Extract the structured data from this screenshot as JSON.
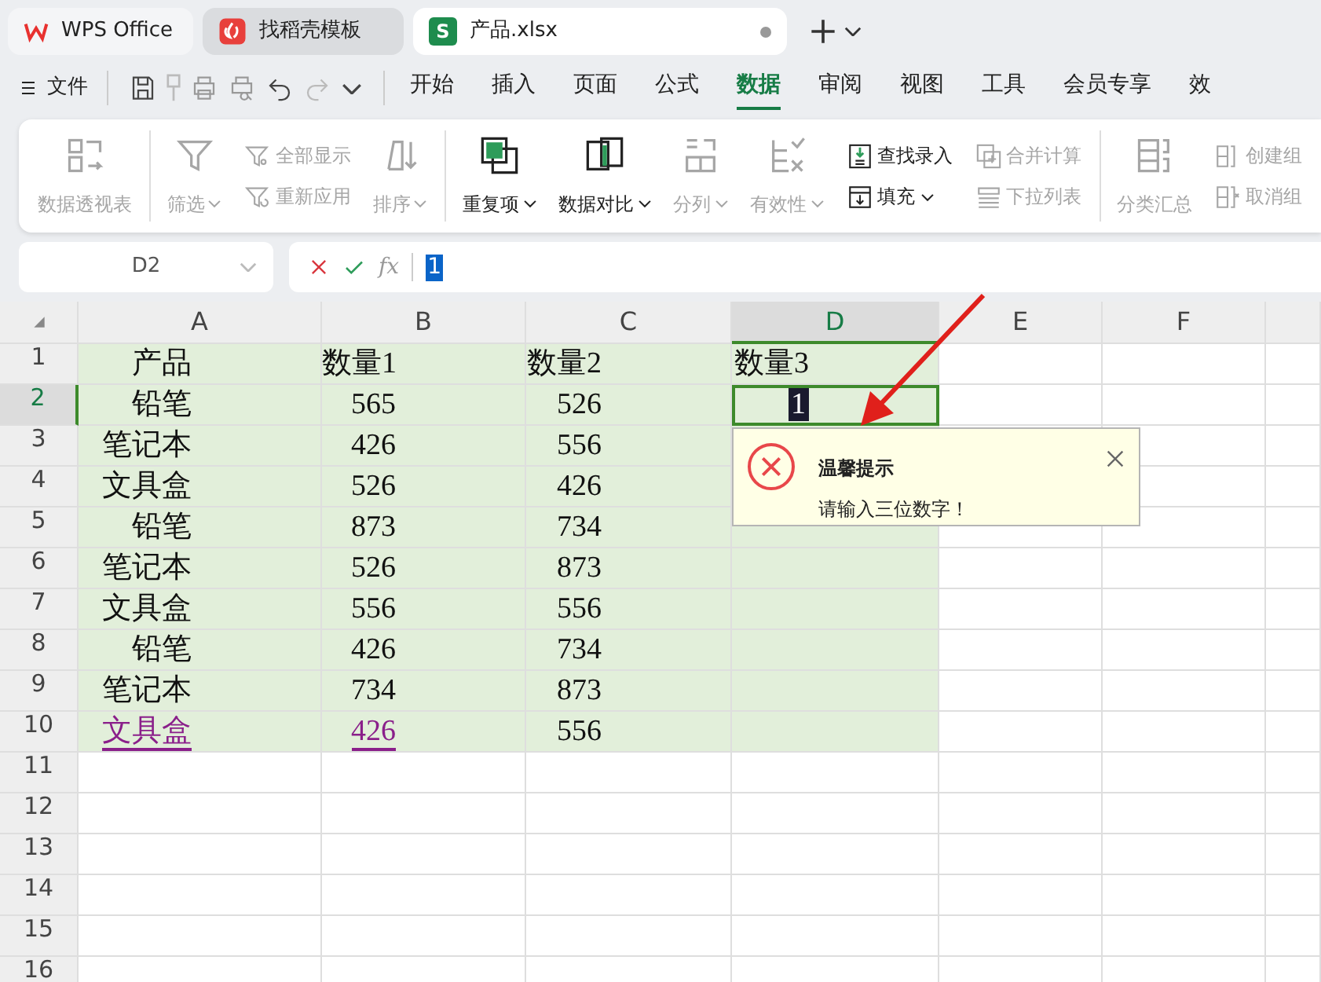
{
  "tabs": [
    {
      "label": "WPS Office",
      "selected": false,
      "kind": "home"
    },
    {
      "label": "找稻壳模板",
      "selected": false,
      "kind": "template"
    },
    {
      "label": "产品.xlsx",
      "selected": true,
      "kind": "sheet",
      "badge": "S",
      "modified": true
    }
  ],
  "menu": {
    "file": "文件",
    "items": [
      {
        "label": "开始",
        "selected": false
      },
      {
        "label": "插入",
        "selected": false
      },
      {
        "label": "页面",
        "selected": false
      },
      {
        "label": "公式",
        "selected": false
      },
      {
        "label": "数据",
        "selected": true
      },
      {
        "label": "审阅",
        "selected": false
      },
      {
        "label": "视图",
        "selected": false
      },
      {
        "label": "工具",
        "selected": false
      },
      {
        "label": "会员专享",
        "selected": false
      },
      {
        "label": "效",
        "selected": false
      }
    ]
  },
  "ribbon": {
    "groups": [
      {
        "tools": [
          {
            "kind": "large",
            "label": "数据透视表",
            "disabled": true,
            "dropdown": false
          }
        ]
      },
      {
        "tools": [
          {
            "kind": "large",
            "label": "筛选",
            "disabled": true,
            "dropdown": true
          },
          {
            "kind": "pair",
            "items": [
              {
                "label": "全部显示",
                "disabled": true,
                "dropdown": false
              },
              {
                "label": "重新应用",
                "disabled": true,
                "dropdown": false
              }
            ]
          },
          {
            "kind": "large",
            "label": "排序",
            "disabled": true,
            "dropdown": true
          }
        ]
      },
      {
        "tools": [
          {
            "kind": "large",
            "label": "重复项",
            "disabled": false,
            "dropdown": true
          },
          {
            "kind": "large",
            "label": "数据对比",
            "disabled": false,
            "dropdown": true
          },
          {
            "kind": "large",
            "label": "分列",
            "disabled": true,
            "dropdown": true
          },
          {
            "kind": "large",
            "label": "有效性",
            "disabled": true,
            "dropdown": true
          },
          {
            "kind": "pair",
            "items": [
              {
                "label": "查找录入",
                "disabled": false,
                "dropdown": false
              },
              {
                "label": "填充",
                "disabled": false,
                "dropdown": true
              }
            ]
          },
          {
            "kind": "pair",
            "items": [
              {
                "label": "合并计算",
                "disabled": true,
                "dropdown": false
              },
              {
                "label": "下拉列表",
                "disabled": true,
                "dropdown": false
              }
            ]
          }
        ]
      },
      {
        "tools": [
          {
            "kind": "large",
            "label": "分类汇总",
            "disabled": true,
            "dropdown": false
          },
          {
            "kind": "pair",
            "items": [
              {
                "label": "创建组",
                "disabled": true,
                "dropdown": false
              },
              {
                "label": "取消组",
                "disabled": true,
                "dropdown": false
              }
            ]
          }
        ]
      }
    ]
  },
  "formula_bar": {
    "name_box": "D2",
    "fx": "fx",
    "value": "1"
  },
  "sheet": {
    "columns": [
      {
        "label": "A",
        "selected": false
      },
      {
        "label": "B",
        "selected": false
      },
      {
        "label": "C",
        "selected": false
      },
      {
        "label": "D",
        "selected": true
      },
      {
        "label": "E",
        "selected": false
      },
      {
        "label": "F",
        "selected": false
      }
    ],
    "rows": [
      {
        "label": "1",
        "selected": false,
        "cells": [
          "产品",
          "数量1",
          "数量2",
          "数量3"
        ]
      },
      {
        "label": "2",
        "selected": true,
        "cells": [
          "铅笔",
          "565",
          "526",
          {
            "text": "1",
            "editing": true
          }
        ]
      },
      {
        "label": "3",
        "selected": false,
        "cells": [
          "笔记本",
          "426",
          "556",
          ""
        ]
      },
      {
        "label": "4",
        "selected": false,
        "cells": [
          "文具盒",
          "526",
          "426",
          ""
        ]
      },
      {
        "label": "5",
        "selected": false,
        "cells": [
          "铅笔",
          "873",
          "734",
          ""
        ]
      },
      {
        "label": "6",
        "selected": false,
        "cells": [
          "笔记本",
          "526",
          "873",
          ""
        ]
      },
      {
        "label": "7",
        "selected": false,
        "cells": [
          "文具盒",
          "556",
          "556",
          ""
        ]
      },
      {
        "label": "8",
        "selected": false,
        "cells": [
          "铅笔",
          "426",
          "734",
          ""
        ]
      },
      {
        "label": "9",
        "selected": false,
        "cells": [
          "笔记本",
          "734",
          "873",
          ""
        ]
      },
      {
        "label": "10",
        "selected": false,
        "cells": [
          {
            "text": "文具盒",
            "link": true
          },
          {
            "text": "426",
            "link": true
          },
          "556",
          ""
        ]
      },
      {
        "label": "11",
        "selected": false
      },
      {
        "label": "12",
        "selected": false
      },
      {
        "label": "13",
        "selected": false
      },
      {
        "label": "14",
        "selected": false
      },
      {
        "label": "15",
        "selected": false
      },
      {
        "label": "16",
        "selected": false
      }
    ]
  },
  "dialog": {
    "title": "温馨提示",
    "message": "请输入三位数字！"
  }
}
